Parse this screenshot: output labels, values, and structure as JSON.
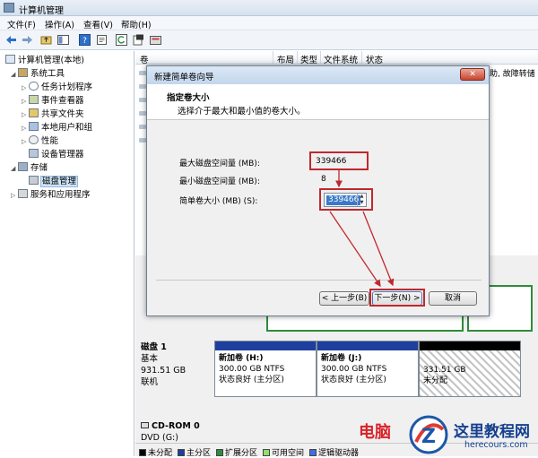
{
  "window": {
    "title": "计算机管理"
  },
  "menu": [
    "文件(F)",
    "操作(A)",
    "查看(V)",
    "帮助(H)"
  ],
  "toolbar": {
    "icons": [
      "back-arrow-icon",
      "forward-arrow-icon",
      "up-folder-icon",
      "console-tree-icon",
      "help-icon",
      "properties-icon",
      "refresh-icon",
      "export-icon",
      "settings-icon"
    ]
  },
  "tree": [
    {
      "label": "计算机管理(本地)",
      "icon": "computer-icon"
    },
    {
      "label": "系统工具",
      "icon": "tools-icon"
    },
    {
      "label": "任务计划程序",
      "icon": "clock-icon"
    },
    {
      "label": "事件查看器",
      "icon": "event-viewer-icon"
    },
    {
      "label": "共享文件夹",
      "icon": "shared-folder-icon"
    },
    {
      "label": "本地用户和组",
      "icon": "users-icon"
    },
    {
      "label": "性能",
      "icon": "performance-icon"
    },
    {
      "label": "设备管理器",
      "icon": "device-manager-icon"
    },
    {
      "label": "存储",
      "icon": "storage-icon"
    },
    {
      "label": "磁盘管理",
      "icon": "disk-icon"
    },
    {
      "label": "服务和应用程序",
      "icon": "services-icon"
    }
  ],
  "list": {
    "headers": [
      "卷",
      "布局",
      "类型",
      "文件系统",
      "状态"
    ],
    "bg_text": "助, 故障转储"
  },
  "disks": [
    {
      "name": "磁盘 1",
      "type": "基本",
      "size": "931.51 GB",
      "status": "联机",
      "partitions": [
        {
          "name": "新加卷  (H:)",
          "size": "300.00 GB NTFS",
          "status": "状态良好 (主分区)"
        },
        {
          "name": "新加卷  (J:)",
          "size": "300.00 GB NTFS",
          "status": "状态良好 (主分区)"
        },
        {
          "name": "",
          "size": "331.51 GB",
          "status": "未分配"
        }
      ]
    },
    {
      "name": "CD-ROM 0",
      "type": "DVD (G:)"
    }
  ],
  "legend": [
    "未分配",
    "主分区",
    "扩展分区",
    "可用空间",
    "逻辑驱动器"
  ],
  "colors": {
    "unallocated": "#000000",
    "primary": "#1f3f9e",
    "extended": "#2e8b3d",
    "free": "#8ee06a",
    "logical": "#3f6fe0",
    "annotation": "#c0282d"
  },
  "wizard": {
    "title": "新建简单卷向导",
    "header_title": "指定卷大小",
    "header_subtitle": "选择介于最大和最小值的卷大小。",
    "max_label": "最大磁盘空间量 (MB):",
    "max_value": "339466",
    "min_label": "最小磁盘空间量 (MB):",
    "min_value": "8",
    "size_label": "简单卷大小 (MB) (S):",
    "size_value": "339466",
    "back": "< 上一步(B)",
    "next": "下一步(N) >",
    "cancel": "取消",
    "close": "✕"
  },
  "watermark": {
    "brand_left": "电脑",
    "site": "这里教程网",
    "url": "herecours.com"
  }
}
